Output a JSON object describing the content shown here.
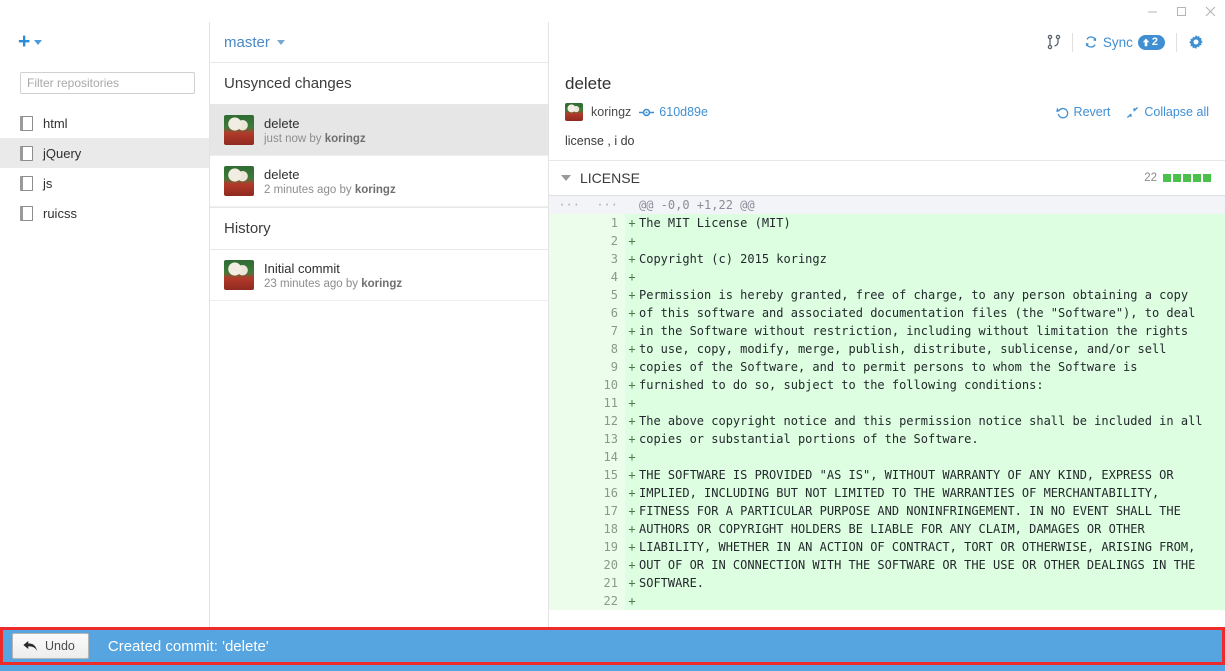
{
  "window": {
    "controls": [
      {
        "name": "minimize",
        "glyph": "minimize-icon"
      },
      {
        "name": "maximize",
        "glyph": "maximize-icon"
      },
      {
        "name": "close",
        "glyph": "close-icon"
      }
    ]
  },
  "sidebar": {
    "add_button_label": "+",
    "filter": {
      "placeholder": "Filter repositories",
      "value": ""
    },
    "repositories": [
      {
        "name": "html",
        "selected": false
      },
      {
        "name": "jQuery",
        "selected": true
      },
      {
        "name": "js",
        "selected": false
      },
      {
        "name": "ruicss",
        "selected": false
      }
    ]
  },
  "commits_panel": {
    "branch": "master",
    "sections": [
      {
        "heading": "Unsynced changes",
        "commits": [
          {
            "title": "delete",
            "meta_time": "just now",
            "meta_by": "by",
            "meta_author": "koringz",
            "selected": true
          },
          {
            "title": "delete",
            "meta_time": "2 minutes ago",
            "meta_by": "by",
            "meta_author": "koringz",
            "selected": false
          }
        ]
      },
      {
        "heading": "History",
        "commits": [
          {
            "title": "Initial commit",
            "meta_time": "23 minutes ago",
            "meta_by": "by",
            "meta_author": "koringz",
            "selected": false
          }
        ]
      }
    ]
  },
  "toolbar": {
    "branch_compare_label": "",
    "sync_label": "Sync",
    "sync_badge_count": "2",
    "sync_badge_direction": "up",
    "settings_label": ""
  },
  "commit_detail": {
    "subject": "delete",
    "author": "koringz",
    "sha": "610d89e",
    "revert_label": "Revert",
    "collapse_label": "Collapse all",
    "body": "license , i do"
  },
  "file": {
    "name": "LICENSE",
    "change_count": "22",
    "blocks": 5,
    "block_color": "#4ac14a"
  },
  "diff": {
    "hunk_header": "@@ -0,0 +1,22 @@",
    "old_gutter": "···",
    "new_gutter": "···",
    "lines": [
      {
        "no": "1",
        "sign": "+",
        "text": "The MIT License (MIT)"
      },
      {
        "no": "2",
        "sign": "+",
        "text": ""
      },
      {
        "no": "3",
        "sign": "+",
        "text": "Copyright (c) 2015 koringz"
      },
      {
        "no": "4",
        "sign": "+",
        "text": ""
      },
      {
        "no": "5",
        "sign": "+",
        "text": "Permission is hereby granted, free of charge, to any person obtaining a copy"
      },
      {
        "no": "6",
        "sign": "+",
        "text": "of this software and associated documentation files (the \"Software\"), to deal"
      },
      {
        "no": "7",
        "sign": "+",
        "text": "in the Software without restriction, including without limitation the rights"
      },
      {
        "no": "8",
        "sign": "+",
        "text": "to use, copy, modify, merge, publish, distribute, sublicense, and/or sell"
      },
      {
        "no": "9",
        "sign": "+",
        "text": "copies of the Software, and to permit persons to whom the Software is"
      },
      {
        "no": "10",
        "sign": "+",
        "text": "furnished to do so, subject to the following conditions:"
      },
      {
        "no": "11",
        "sign": "+",
        "text": ""
      },
      {
        "no": "12",
        "sign": "+",
        "text": "The above copyright notice and this permission notice shall be included in all"
      },
      {
        "no": "13",
        "sign": "+",
        "text": "copies or substantial portions of the Software."
      },
      {
        "no": "14",
        "sign": "+",
        "text": ""
      },
      {
        "no": "15",
        "sign": "+",
        "text": "THE SOFTWARE IS PROVIDED \"AS IS\", WITHOUT WARRANTY OF ANY KIND, EXPRESS OR"
      },
      {
        "no": "16",
        "sign": "+",
        "text": "IMPLIED, INCLUDING BUT NOT LIMITED TO THE WARRANTIES OF MERCHANTABILITY,"
      },
      {
        "no": "17",
        "sign": "+",
        "text": "FITNESS FOR A PARTICULAR PURPOSE AND NONINFRINGEMENT. IN NO EVENT SHALL THE"
      },
      {
        "no": "18",
        "sign": "+",
        "text": "AUTHORS OR COPYRIGHT HOLDERS BE LIABLE FOR ANY CLAIM, DAMAGES OR OTHER"
      },
      {
        "no": "19",
        "sign": "+",
        "text": "LIABILITY, WHETHER IN AN ACTION OF CONTRACT, TORT OR OTHERWISE, ARISING FROM,"
      },
      {
        "no": "20",
        "sign": "+",
        "text": "OUT OF OR IN CONNECTION WITH THE SOFTWARE OR THE USE OR OTHER DEALINGS IN THE"
      },
      {
        "no": "21",
        "sign": "+",
        "text": "SOFTWARE."
      },
      {
        "no": "22",
        "sign": "+",
        "text": ""
      }
    ]
  },
  "notification": {
    "undo_label": "Undo",
    "message": "Created commit: 'delete'",
    "background": "#56a5e0",
    "highlight_border": "#ee2b2b"
  }
}
